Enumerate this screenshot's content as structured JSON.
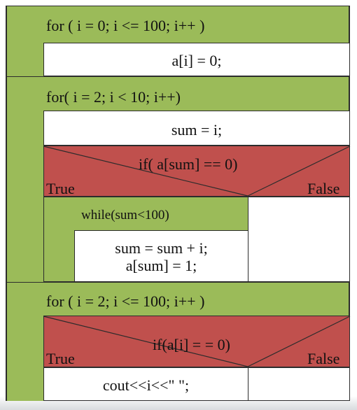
{
  "loop1": {
    "header": "for ( i = 0; i <= 100; i++ )",
    "body": "a[i] = 0;"
  },
  "loop2": {
    "header": "for( i = 2; i < 10; i++)",
    "assign": "sum = i;",
    "decision": {
      "condition": "if( a[sum] == 0)",
      "true_label": "True",
      "false_label": "False"
    },
    "while": {
      "header": "while(sum<100)",
      "body_line1": "sum = sum + i;",
      "body_line2": "a[sum] = 1;"
    }
  },
  "loop3": {
    "header": "for ( i = 2; i <= 100; i++ )",
    "decision": {
      "condition": "if(a[i] = = 0)",
      "true_label": "True",
      "false_label": "False"
    },
    "output": "cout<<i<<\" \";"
  },
  "colors": {
    "loop": "#9bbb59",
    "decision": "#c0504d",
    "statement": "#ffffff",
    "border": "#2c2c2c"
  }
}
